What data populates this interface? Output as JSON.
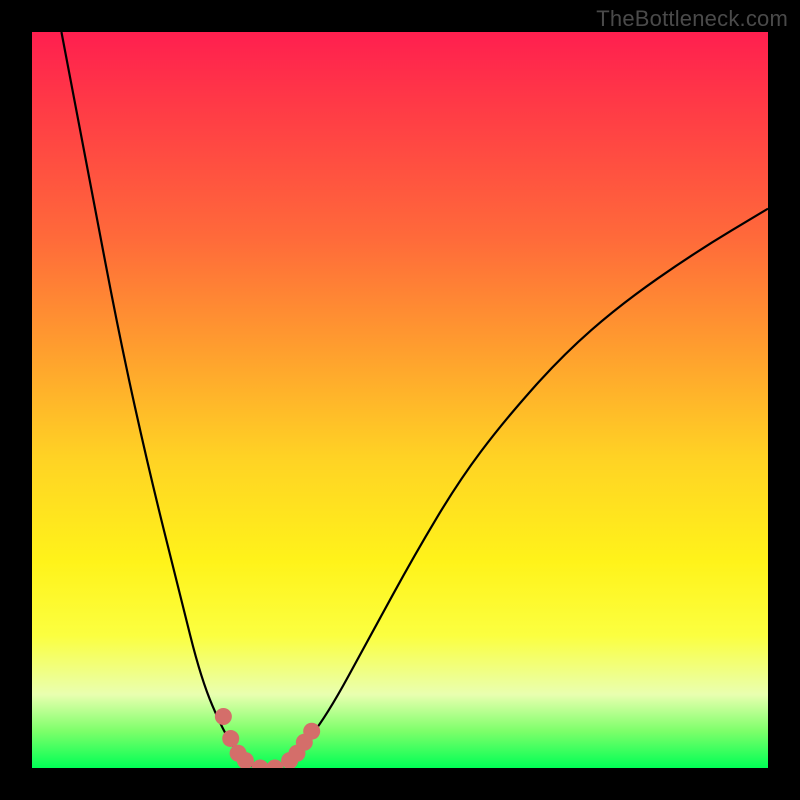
{
  "watermark": "TheBottleneck.com",
  "chart_data": {
    "type": "line",
    "title": "",
    "xlabel": "",
    "ylabel": "",
    "xlim": [
      0,
      100
    ],
    "ylim": [
      0,
      100
    ],
    "grid": false,
    "legend": false,
    "background_gradient": {
      "direction": "vertical",
      "stops": [
        {
          "pos": 0,
          "color": "#ff1f4f"
        },
        {
          "pos": 28,
          "color": "#ff6a3a"
        },
        {
          "pos": 58,
          "color": "#ffd324"
        },
        {
          "pos": 82,
          "color": "#fbff40"
        },
        {
          "pos": 95,
          "color": "#7dff6a"
        },
        {
          "pos": 100,
          "color": "#00ff55"
        }
      ]
    },
    "series": [
      {
        "name": "bottleneck-curve",
        "x": [
          4,
          8,
          12,
          16,
          20,
          23,
          26,
          28,
          30,
          32,
          34,
          36,
          40,
          46,
          52,
          58,
          64,
          72,
          80,
          90,
          100
        ],
        "values": [
          100,
          79,
          58,
          40,
          24,
          12,
          5,
          2,
          0,
          0,
          0.5,
          2,
          7,
          18,
          29,
          39,
          47,
          56,
          63,
          70,
          76
        ]
      }
    ],
    "markers": {
      "name": "highlighted-range",
      "color": "#d46e6a",
      "points": [
        {
          "x": 26,
          "y": 7
        },
        {
          "x": 27,
          "y": 4
        },
        {
          "x": 28,
          "y": 2
        },
        {
          "x": 29,
          "y": 1
        },
        {
          "x": 31,
          "y": 0
        },
        {
          "x": 33,
          "y": 0
        },
        {
          "x": 35,
          "y": 1
        },
        {
          "x": 36,
          "y": 2
        },
        {
          "x": 37,
          "y": 3.5
        },
        {
          "x": 38,
          "y": 5
        }
      ]
    }
  }
}
